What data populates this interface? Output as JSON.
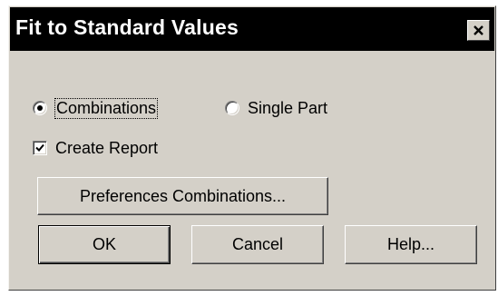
{
  "dialog": {
    "title": "Fit to Standard Values"
  },
  "options": {
    "mode": {
      "combinations_label": "Combinations",
      "single_part_label": "Single Part",
      "selected": "Combinations"
    },
    "create_report": {
      "label": "Create Report",
      "checked": true
    }
  },
  "buttons": {
    "preferences": "Preferences Combinations...",
    "ok": "OK",
    "cancel": "Cancel",
    "help": "Help..."
  },
  "icons": {
    "close": "close-icon",
    "check": "checkmark-icon"
  },
  "colors": {
    "titlebar_bg": "#000000",
    "titlebar_text": "#ffffff",
    "dialog_bg": "#d4d0c8"
  }
}
